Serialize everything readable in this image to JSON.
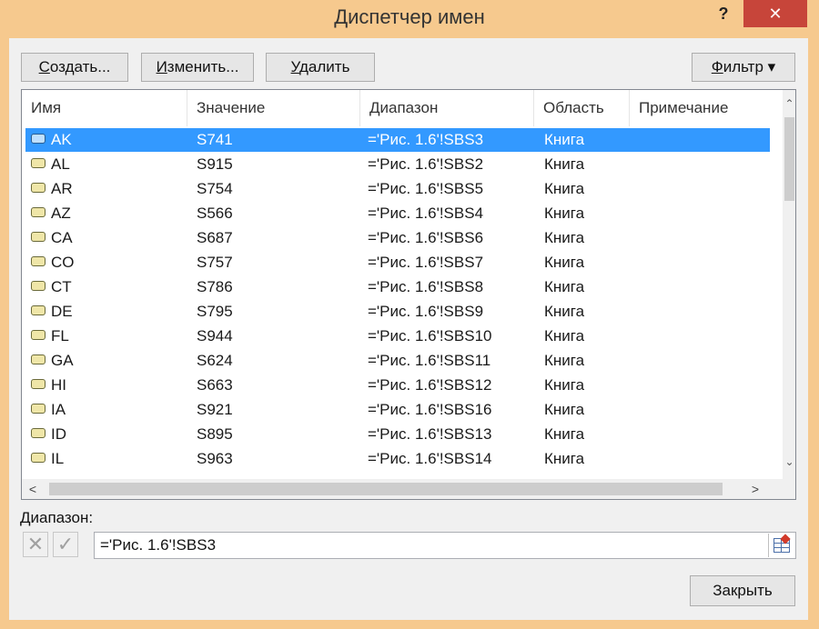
{
  "window": {
    "title": "Диспетчер имен",
    "help": "?",
    "close_glyph": "✕"
  },
  "toolbar": {
    "create_pre": "",
    "create_ul": "С",
    "create_post": "оздать...",
    "edit_pre": "",
    "edit_ul": "И",
    "edit_post": "зменить...",
    "delete_pre": "",
    "delete_ul": "У",
    "delete_post": "далить",
    "filter_pre": "",
    "filter_ul": "Ф",
    "filter_post": "ильтр ▾"
  },
  "columns": [
    "Имя",
    "Значение",
    "Диапазон",
    "Область",
    "Примечание"
  ],
  "rows": [
    {
      "name": "AK",
      "value": "S741",
      "range": "='Рис. 1.6'!SBS3",
      "scope": "Книга",
      "selected": true
    },
    {
      "name": "AL",
      "value": "S915",
      "range": "='Рис. 1.6'!SBS2",
      "scope": "Книга"
    },
    {
      "name": "AR",
      "value": "S754",
      "range": "='Рис. 1.6'!SBS5",
      "scope": "Книга"
    },
    {
      "name": "AZ",
      "value": "S566",
      "range": "='Рис. 1.6'!SBS4",
      "scope": "Книга"
    },
    {
      "name": "CA",
      "value": "S687",
      "range": "='Рис. 1.6'!SBS6",
      "scope": "Книга"
    },
    {
      "name": "CO",
      "value": "S757",
      "range": "='Рис. 1.6'!SBS7",
      "scope": "Книга"
    },
    {
      "name": "CT",
      "value": "S786",
      "range": "='Рис. 1.6'!SBS8",
      "scope": "Книга"
    },
    {
      "name": "DE",
      "value": "S795",
      "range": "='Рис. 1.6'!SBS9",
      "scope": "Книга"
    },
    {
      "name": "FL",
      "value": "S944",
      "range": "='Рис. 1.6'!SBS10",
      "scope": "Книга"
    },
    {
      "name": "GA",
      "value": "S624",
      "range": "='Рис. 1.6'!SBS11",
      "scope": "Книга"
    },
    {
      "name": "HI",
      "value": "S663",
      "range": "='Рис. 1.6'!SBS12",
      "scope": "Книга"
    },
    {
      "name": "IA",
      "value": "S921",
      "range": "='Рис. 1.6'!SBS16",
      "scope": "Книга"
    },
    {
      "name": "ID",
      "value": "S895",
      "range": "='Рис. 1.6'!SBS13",
      "scope": "Книга"
    },
    {
      "name": "IL",
      "value": "S963",
      "range": "='Рис. 1.6'!SBS14",
      "scope": "Книга"
    }
  ],
  "scroll": {
    "up": "⌃",
    "down": "⌄",
    "left": "<",
    "right": ">"
  },
  "range": {
    "label": "Диапазон:",
    "value": "='Рис. 1.6'!SBS3",
    "cancel_glyph": "✕",
    "confirm_glyph": "✓"
  },
  "footer": {
    "close_label": "Закрыть"
  },
  "colors": {
    "selection": "#3399ff",
    "frame": "#f6c98e",
    "close_red": "#c7453a"
  }
}
